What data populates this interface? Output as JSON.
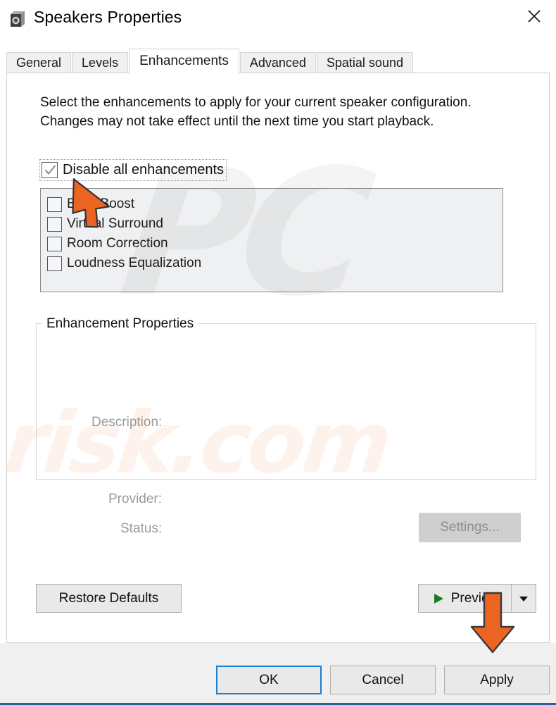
{
  "window": {
    "title": "Speakers Properties",
    "icon": "speaker-icon",
    "close_label": "✕",
    "accent_blue": "#1d7fd1",
    "bottom_border_color": "#2a6099"
  },
  "tabs": [
    {
      "label": "General",
      "active": false
    },
    {
      "label": "Levels",
      "active": false
    },
    {
      "label": "Enhancements",
      "active": true
    },
    {
      "label": "Advanced",
      "active": false
    },
    {
      "label": "Spatial sound",
      "active": false
    }
  ],
  "panel": {
    "intro_text": "Select the enhancements to apply for your current speaker configuration. Changes may not take effect until the next time you start playback.",
    "disable_all": {
      "label": "Disable all enhancements",
      "checked": true,
      "focused": true,
      "check_color": "#8a8a8a"
    },
    "enhancements": [
      {
        "label": "Bass Boost",
        "checked": false
      },
      {
        "label": "Virtual Surround",
        "checked": false
      },
      {
        "label": "Room Correction",
        "checked": false
      },
      {
        "label": "Loudness Equalization",
        "checked": false
      }
    ],
    "properties_group": {
      "legend": "Enhancement Properties",
      "description_label": "Description:",
      "description_value": "",
      "provider_label": "Provider:",
      "provider_value": "",
      "status_label": "Status:",
      "status_value": "",
      "settings_button": "Settings...",
      "settings_disabled": true
    },
    "restore_defaults_button": "Restore Defaults",
    "preview": {
      "label": "Preview",
      "play_icon": "play-triangle-icon",
      "play_color": "#1a7a23",
      "dropdown_icon": "chevron-down-icon"
    }
  },
  "button_bar": {
    "ok": "OK",
    "cancel": "Cancel",
    "apply": "Apply",
    "default_focus": "OK"
  },
  "watermark": {
    "logo_text": "PC",
    "site_text": "risk.com"
  },
  "annotations": {
    "cursor_arrow": "orange-cursor-arrow",
    "down_arrow": "orange-down-arrow",
    "arrow_color": "#ec6422"
  }
}
